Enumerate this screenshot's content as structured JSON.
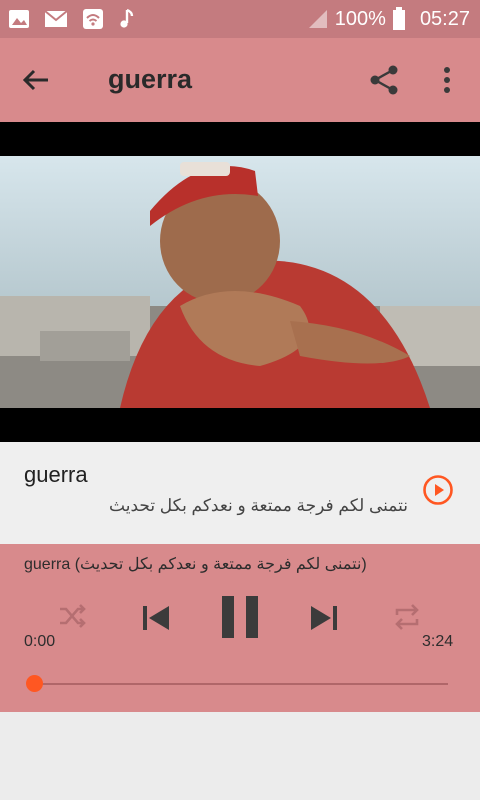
{
  "status_bar": {
    "battery": "100%",
    "time": "05:27"
  },
  "app_bar": {
    "title": "guerra"
  },
  "track": {
    "title": "guerra",
    "subtitle": "نتمنى لكم فرجة ممتعة و نعدكم بكل تحديث"
  },
  "player": {
    "now_playing": "guerra (نتمنى لكم فرجة ممتعة و نعدكم بكل تحديث)",
    "elapsed": "0:00",
    "duration": "3:24",
    "progress": 0
  },
  "colors": {
    "accent": "#ff5722",
    "app_bar": "#d88a8c",
    "status_bar": "#c47b7f"
  }
}
